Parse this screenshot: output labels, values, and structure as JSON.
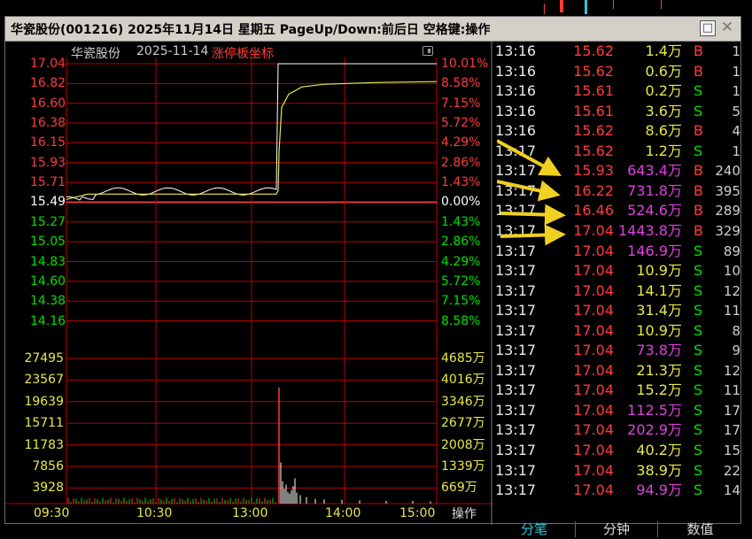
{
  "window": {
    "title": "华瓷股份(001216) 2025年11月14日 星期五 PageUp/Down:前后日 空格键:操作",
    "max_glyph": "□",
    "close_glyph": "✕"
  },
  "chart": {
    "stock_name": "华瓷股份",
    "date": "2025-11-14",
    "marker_label": "涨停板坐标",
    "price_labels": [
      "17.04",
      "16.82",
      "16.60",
      "16.38",
      "16.15",
      "15.93",
      "15.71",
      "15.49",
      "15.27",
      "15.05",
      "14.83",
      "14.60",
      "14.38",
      "14.16"
    ],
    "pct_labels": [
      "10.01%",
      "8.58%",
      "7.15%",
      "5.72%",
      "4.29%",
      "2.86%",
      "1.43%",
      "0.00%",
      "1.43%",
      "2.86%",
      "4.29%",
      "5.72%",
      "7.15%",
      "8.58%"
    ],
    "vol_labels_left": [
      "27495",
      "23567",
      "19639",
      "15711",
      "11783",
      "7856",
      "3928"
    ],
    "vol_labels_right": [
      "4685万",
      "4016万",
      "3346万",
      "2677万",
      "2008万",
      "1339万",
      "669万"
    ],
    "time_labels": [
      "09:30",
      "10:30",
      "13:00",
      "14:00",
      "15:00"
    ],
    "operate_label": "操作",
    "colors": {
      "up": "#ff3b3b",
      "down": "#00e000",
      "price_line": "#e8e84a",
      "grid": "#b80000"
    }
  },
  "trades": [
    {
      "time": "13:16",
      "price": "15.62",
      "vol": "1.4",
      "unit": "万",
      "side": "B",
      "count": "1",
      "big": false
    },
    {
      "time": "13:16",
      "price": "15.62",
      "vol": "0.6",
      "unit": "万",
      "side": "B",
      "count": "1",
      "big": false
    },
    {
      "time": "13:16",
      "price": "15.61",
      "vol": "0.2",
      "unit": "万",
      "side": "S",
      "count": "1",
      "big": false
    },
    {
      "time": "13:16",
      "price": "15.61",
      "vol": "3.6",
      "unit": "万",
      "side": "S",
      "count": "5",
      "big": false
    },
    {
      "time": "13:16",
      "price": "15.62",
      "vol": "8.6",
      "unit": "万",
      "side": "B",
      "count": "4",
      "big": false
    },
    {
      "time": "13:17",
      "price": "15.62",
      "vol": "1.2",
      "unit": "万",
      "side": "S",
      "count": "1",
      "big": false
    },
    {
      "time": "13:17",
      "price": "15.93",
      "vol": "643.4",
      "unit": "万",
      "side": "B",
      "count": "240",
      "big": true
    },
    {
      "time": "13:17",
      "price": "16.22",
      "vol": "731.8",
      "unit": "万",
      "side": "B",
      "count": "395",
      "big": true
    },
    {
      "time": "13:17",
      "price": "16.46",
      "vol": "524.6",
      "unit": "万",
      "side": "B",
      "count": "289",
      "big": true
    },
    {
      "time": "13:17",
      "price": "17.04",
      "vol": "1443.8",
      "unit": "万",
      "side": "B",
      "count": "329",
      "big": true
    },
    {
      "time": "13:17",
      "price": "17.04",
      "vol": "146.9",
      "unit": "万",
      "side": "S",
      "count": "89",
      "big": true
    },
    {
      "time": "13:17",
      "price": "17.04",
      "vol": "10.9",
      "unit": "万",
      "side": "S",
      "count": "10",
      "big": false
    },
    {
      "time": "13:17",
      "price": "17.04",
      "vol": "14.1",
      "unit": "万",
      "side": "S",
      "count": "12",
      "big": false
    },
    {
      "time": "13:17",
      "price": "17.04",
      "vol": "31.4",
      "unit": "万",
      "side": "S",
      "count": "11",
      "big": false
    },
    {
      "time": "13:17",
      "price": "17.04",
      "vol": "10.9",
      "unit": "万",
      "side": "S",
      "count": "8",
      "big": false
    },
    {
      "time": "13:17",
      "price": "17.04",
      "vol": "73.8",
      "unit": "万",
      "side": "S",
      "count": "9",
      "big": true
    },
    {
      "time": "13:17",
      "price": "17.04",
      "vol": "21.3",
      "unit": "万",
      "side": "S",
      "count": "12",
      "big": false
    },
    {
      "time": "13:17",
      "price": "17.04",
      "vol": "15.2",
      "unit": "万",
      "side": "S",
      "count": "11",
      "big": false
    },
    {
      "time": "13:17",
      "price": "17.04",
      "vol": "112.5",
      "unit": "万",
      "side": "S",
      "count": "17",
      "big": true
    },
    {
      "time": "13:17",
      "price": "17.04",
      "vol": "202.9",
      "unit": "万",
      "side": "S",
      "count": "17",
      "big": true
    },
    {
      "time": "13:17",
      "price": "17.04",
      "vol": "40.2",
      "unit": "万",
      "side": "S",
      "count": "15",
      "big": false
    },
    {
      "time": "13:17",
      "price": "17.04",
      "vol": "38.9",
      "unit": "万",
      "side": "S",
      "count": "22",
      "big": false
    },
    {
      "time": "13:17",
      "price": "17.04",
      "vol": "94.9",
      "unit": "万",
      "side": "S",
      "count": "14",
      "big": true
    }
  ],
  "tabs": [
    {
      "label": "分笔",
      "active": true
    },
    {
      "label": "分钟",
      "active": false
    },
    {
      "label": "数值",
      "active": false
    }
  ]
}
